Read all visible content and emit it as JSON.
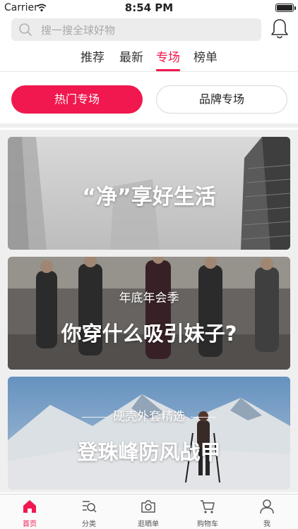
{
  "status_bar": {
    "carrier": "Carrier",
    "time": "8:54 PM",
    "battery_level": 1.0
  },
  "search": {
    "placeholder": "搜一搜全球好物"
  },
  "tabs": [
    {
      "label": "推荐",
      "active": false
    },
    {
      "label": "最新",
      "active": false
    },
    {
      "label": "专场",
      "active": true
    },
    {
      "label": "榜单",
      "active": false
    }
  ],
  "segments": {
    "hot": "热门专场",
    "brand": "品牌专场"
  },
  "banners": [
    {
      "title": "“净”享好生活",
      "subtitle": ""
    },
    {
      "title": "你穿什么吸引妹子?",
      "subtitle": "年底年会季"
    },
    {
      "title": "登珠峰防风战甲",
      "subtitle": "硬壳外套精选"
    }
  ],
  "tabbar": [
    {
      "label": "首页",
      "icon": "home-icon",
      "active": true
    },
    {
      "label": "分类",
      "icon": "category-icon",
      "active": false
    },
    {
      "label": "逛晒单",
      "icon": "camera-icon",
      "active": false
    },
    {
      "label": "购物车",
      "icon": "cart-icon",
      "active": false
    },
    {
      "label": "我",
      "icon": "user-icon",
      "active": false
    }
  ],
  "colors": {
    "accent": "#f0184e",
    "background": "#efefef"
  }
}
